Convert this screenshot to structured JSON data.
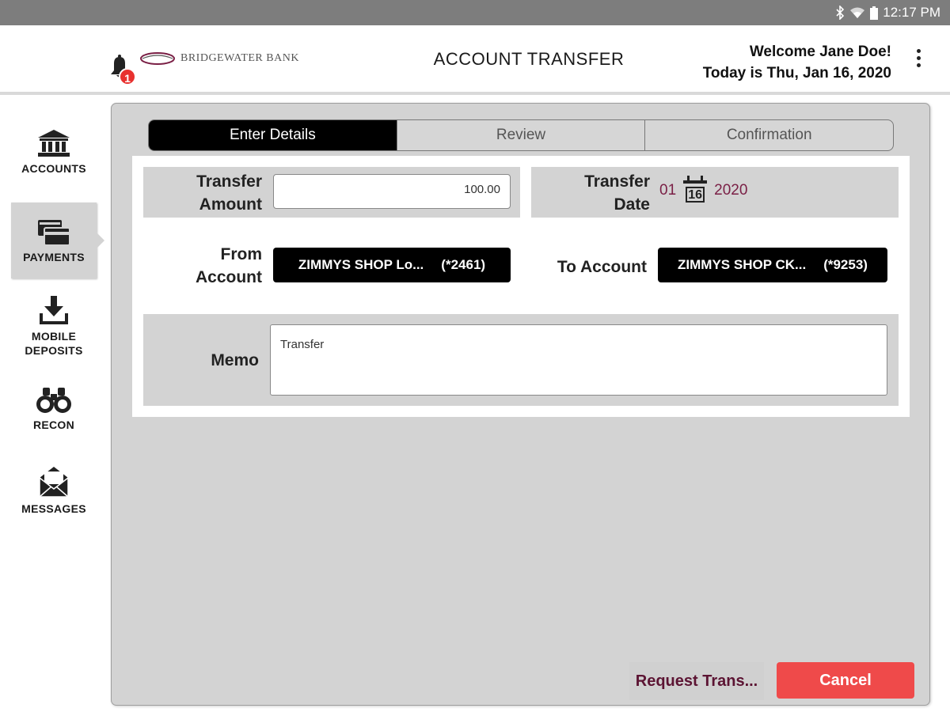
{
  "status_bar": {
    "time": "12:17 PM",
    "icons": [
      "bluetooth-icon",
      "wifi-icon",
      "battery-icon"
    ]
  },
  "header": {
    "bank_name": "BRIDGEWATER BANK",
    "title": "ACCOUNT TRANSFER",
    "welcome": "Welcome Jane Doe!",
    "today": "Today is Thu, Jan 16, 2020",
    "notification_count": "1"
  },
  "sidebar": {
    "items": [
      {
        "label": "ACCOUNTS",
        "icon": "bank-icon",
        "active": false
      },
      {
        "label": "PAYMENTS",
        "icon": "cards-icon",
        "active": true
      },
      {
        "label_line1": "MOBILE",
        "label_line2": "DEPOSITS",
        "icon": "download-icon",
        "active": false
      },
      {
        "label": "RECON",
        "icon": "binoculars-icon",
        "active": false
      },
      {
        "label": "MESSAGES",
        "icon": "envelope-icon",
        "active": false
      }
    ]
  },
  "steps": [
    {
      "label": "Enter Details",
      "active": true
    },
    {
      "label": "Review",
      "active": false
    },
    {
      "label": "Confirmation",
      "active": false
    }
  ],
  "form": {
    "transfer_amount_label_1": "Transfer",
    "transfer_amount_label_2": "Amount",
    "transfer_amount_value": "100.00",
    "transfer_date_label_1": "Transfer",
    "transfer_date_label_2": "Date",
    "date_month": "01",
    "date_day": "16",
    "date_year": "2020",
    "from_label_1": "From",
    "from_label_2": "Account",
    "from_account_name": "ZIMMYS SHOP Lo...",
    "from_account_number": "(*2461)",
    "to_label": "To Account",
    "to_account_name": "ZIMMYS SHOP CK...",
    "to_account_number": "(*9253)",
    "memo_label": "Memo",
    "memo_value": "Transfer"
  },
  "actions": {
    "request_label": "Request Trans...",
    "cancel_label": "Cancel"
  },
  "colors": {
    "cancel": "#ef4a4a",
    "request_text": "#5c1433",
    "date_text": "#7a1f45",
    "badge": "#e8312f"
  }
}
